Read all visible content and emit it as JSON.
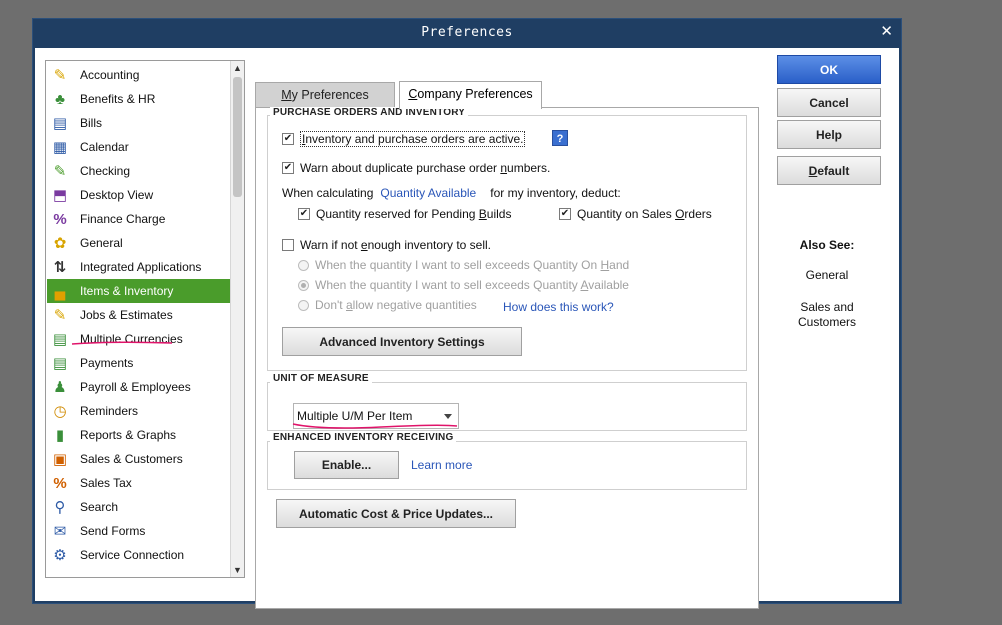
{
  "window": {
    "title": "Preferences",
    "close_glyph": "✕"
  },
  "categories": [
    {
      "label": "Accounting",
      "icon": "accounting-icon"
    },
    {
      "label": "Benefits & HR",
      "icon": "benefits-icon"
    },
    {
      "label": "Bills",
      "icon": "bills-icon"
    },
    {
      "label": "Calendar",
      "icon": "calendar-icon"
    },
    {
      "label": "Checking",
      "icon": "checking-icon"
    },
    {
      "label": "Desktop View",
      "icon": "desktop-view-icon"
    },
    {
      "label": "Finance Charge",
      "icon": "finance-charge-icon"
    },
    {
      "label": "General",
      "icon": "general-icon"
    },
    {
      "label": "Integrated Applications",
      "icon": "integrated-apps-icon"
    },
    {
      "label": "Items & Inventory",
      "icon": "items-inventory-icon",
      "selected": true
    },
    {
      "label": "Jobs & Estimates",
      "icon": "jobs-estimates-icon"
    },
    {
      "label": "Multiple Currencies",
      "icon": "currencies-icon"
    },
    {
      "label": "Payments",
      "icon": "payments-icon"
    },
    {
      "label": "Payroll & Employees",
      "icon": "payroll-icon"
    },
    {
      "label": "Reminders",
      "icon": "reminders-icon"
    },
    {
      "label": "Reports & Graphs",
      "icon": "reports-icon"
    },
    {
      "label": "Sales & Customers",
      "icon": "sales-customers-icon"
    },
    {
      "label": "Sales Tax",
      "icon": "sales-tax-icon"
    },
    {
      "label": "Search",
      "icon": "search-icon"
    },
    {
      "label": "Send Forms",
      "icon": "send-forms-icon"
    },
    {
      "label": "Service Connection",
      "icon": "service-connection-icon"
    }
  ],
  "tabs": {
    "my_prefs": {
      "mn": "M",
      "rest": "y Preferences"
    },
    "company_prefs": {
      "mn": "C",
      "rest": "ompany Preferences"
    }
  },
  "purchase_orders": {
    "title": "PURCHASE ORDERS AND INVENTORY",
    "inventory_active": {
      "pre": "",
      "mn": "I",
      "post": "nventory and purchase orders are active.",
      "checked": true
    },
    "help_glyph": "?",
    "warn_duplicate": {
      "pre": "Warn about duplicate purchase order ",
      "mn": "n",
      "post": "umbers.",
      "checked": true
    },
    "when_calculating": "When calculating",
    "quantity_available_link": "Quantity Available",
    "for_my_inventory": "for my inventory, deduct:",
    "qty_pending_builds": {
      "pre": "Quantity reserved for Pending ",
      "mn": "B",
      "post": "uilds",
      "checked": true
    },
    "qty_sales_orders": {
      "pre": "Quantity on Sales ",
      "mn": "O",
      "post": "rders",
      "checked": true
    },
    "warn_not_enough": {
      "pre": "Warn if not ",
      "mn": "e",
      "post": "nough inventory to sell.",
      "checked": false
    },
    "radio_on_hand": {
      "pre": "When the quantity I want to sell exceeds Quantity On ",
      "mn": "H",
      "post": "and"
    },
    "radio_available": {
      "pre": "When the quantity I want to sell exceeds Quantity ",
      "mn": "A",
      "post": "vailable",
      "selected": true
    },
    "radio_negative": {
      "pre": "Don't ",
      "mn": "a",
      "post": "llow negative quantities"
    },
    "how_does_this_work": "How does this work?",
    "advanced_button": "Advanced Inventory Settings"
  },
  "unit_of_measure": {
    "title": "UNIT OF MEASURE",
    "selected": "Multiple U/M Per Item"
  },
  "enhanced_receiving": {
    "title": "ENHANCED INVENTORY RECEIVING",
    "enable_button": "Enable...",
    "learn_more": "Learn more"
  },
  "automatic_cost_button": "Automatic Cost & Price Updates...",
  "buttons": {
    "ok": "OK",
    "cancel": "Cancel",
    "help": "Help",
    "default": {
      "mn": "D",
      "rest": "efault"
    }
  },
  "see_also": {
    "title": "Also See:",
    "general": "General",
    "sales_customers_line1": "Sales and",
    "sales_customers_line2": "Customers"
  },
  "colors": {
    "selected_item_bg": "#4a9c2b",
    "primary_button": "#2a5fc8",
    "link": "#2a56b8",
    "annotation_ink": "#e0136a"
  }
}
